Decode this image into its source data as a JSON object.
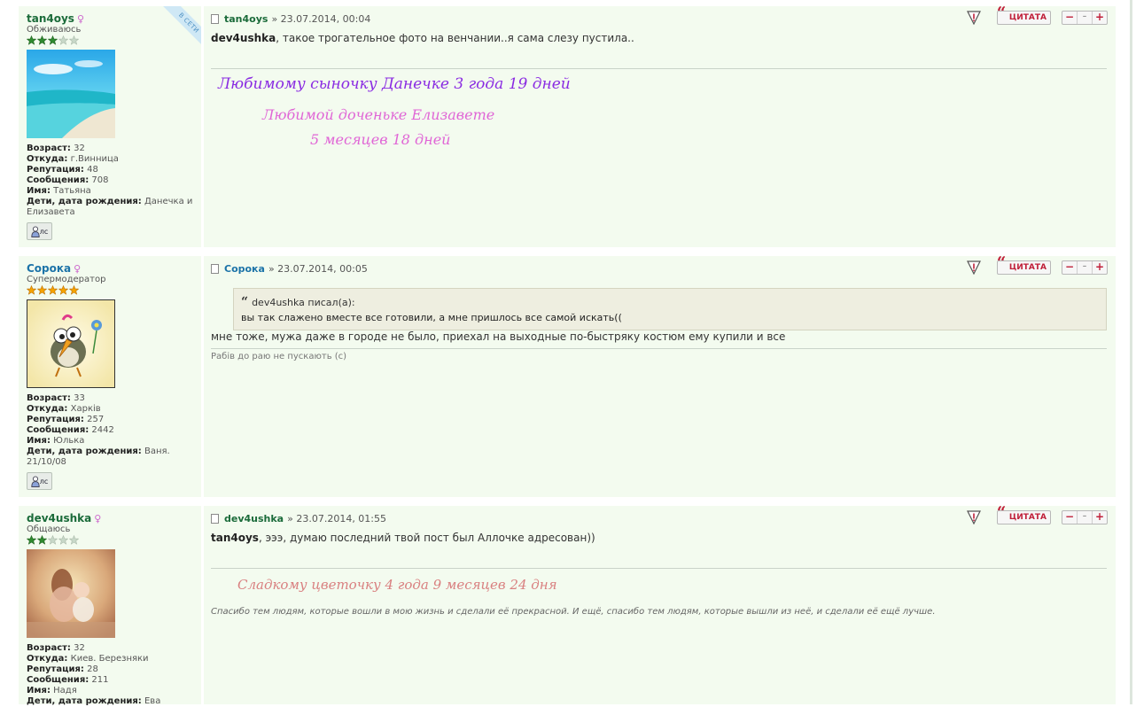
{
  "posts": [
    {
      "username": "tan4oys",
      "rank": "Обживаюсь",
      "online_label": "В СЕТИ",
      "star_count": 3,
      "fields": [
        {
          "label": "Возраст:",
          "value": "32"
        },
        {
          "label": "Откуда:",
          "value": "г.Винница"
        },
        {
          "label": "Репутация:",
          "value": "48"
        },
        {
          "label": "Сообщения:",
          "value": "708"
        },
        {
          "label": "Имя:",
          "value": "Татьяна"
        },
        {
          "label": "Дети, дата рождения:",
          "value": "Данечка и Елизавета"
        }
      ],
      "pm_label": "лс",
      "author": "tan4oys",
      "date": "» 23.07.2014, 00:04",
      "quote_label": "ЦИТАТА",
      "body_user": "dev4ushka",
      "body_text": ", такое трогательное фото на венчании..я сама слезу пустила..",
      "signature": [
        "Любимому сыночку Данечке 3 года 19 дней",
        "Любимой доченьке Елизавете",
        "5 месяцев 18 дней"
      ]
    },
    {
      "username": "Сорока",
      "rank": "Супермодератор",
      "star_count": 5,
      "fields": [
        {
          "label": "Возраст:",
          "value": "33"
        },
        {
          "label": "Откуда:",
          "value": "Харків"
        },
        {
          "label": "Репутация:",
          "value": "257"
        },
        {
          "label": "Сообщения:",
          "value": "2442"
        },
        {
          "label": "Имя:",
          "value": "Юлька"
        },
        {
          "label": "Дети, дата рождения:",
          "value": "Ваня. 21/10/08"
        }
      ],
      "pm_label": "лс",
      "author": "Сорока",
      "date": "» 23.07.2014, 00:05",
      "quote_label": "ЦИТАТА",
      "quote_author": "dev4ushka писал(а):",
      "quote_text": "вы так слажено вместе все готовили, а мне пришлось все самой искать((",
      "body_text": "мне тоже, мужа даже в городе не было, приехал на выходные по-быстряку костюм ему купили и все",
      "signature": "Рабів до раю не пускають (с)"
    },
    {
      "username": "dev4ushka",
      "rank": "Общаюсь",
      "star_count": 2,
      "fields": [
        {
          "label": "Возраст:",
          "value": "32"
        },
        {
          "label": "Откуда:",
          "value": "Киев. Березняки"
        },
        {
          "label": "Репутация:",
          "value": "28"
        },
        {
          "label": "Сообщения:",
          "value": "211"
        },
        {
          "label": "Имя:",
          "value": "Надя"
        },
        {
          "label": "Дети, дата рождения:",
          "value": "Ева"
        }
      ],
      "author": "dev4ushka",
      "date": "» 23.07.2014, 01:55",
      "quote_label": "ЦИТАТА",
      "body_user": "tan4oys",
      "body_text": ", эээ, думаю последний твой пост был Аллочке адресован))",
      "signature_script": "Сладкому цветочку 4 года 9 месяцев 24 дня",
      "signature_text": "Спасибо тем людям, которые вошли в мою жизнь и сделали её прекрасной. И ещё, спасибо тем людям, которые вышли из неё, и сделали её ещё лучше."
    }
  ],
  "colors": {
    "post_bg": "#f3fbef",
    "username_green": "#1b6b3a",
    "username_blue": "#1c73a8",
    "quote_red": "#c0203a",
    "sig_purple": "#8a2be2",
    "sig_pink": "#e066d6",
    "sig_rose": "#d98080"
  }
}
